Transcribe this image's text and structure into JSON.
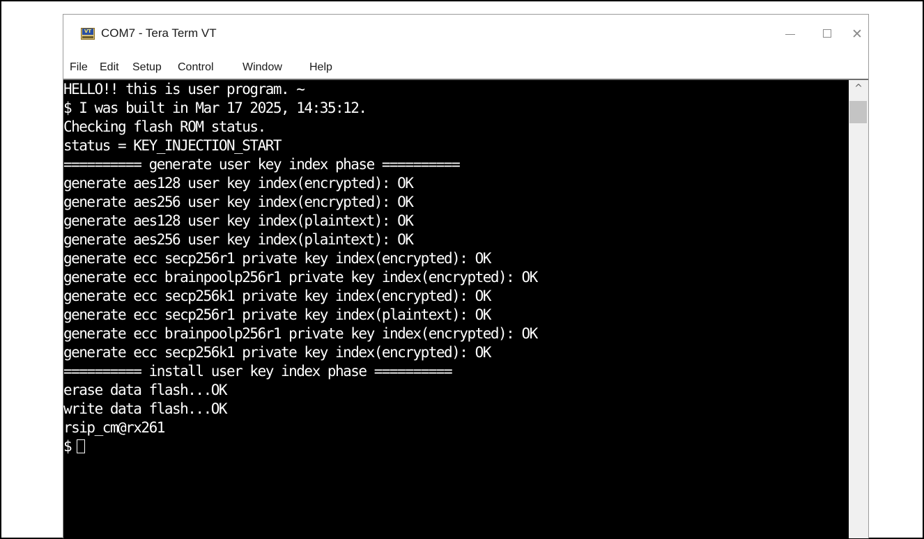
{
  "window": {
    "title": "COM7 - Tera Term VT",
    "icon_label": "VT",
    "icon": "tera-term-app-icon",
    "controls": {
      "minimize": "minimize-icon",
      "maximize": "maximize-icon",
      "close": "close-icon"
    }
  },
  "menu": {
    "file": "File",
    "edit": "Edit",
    "setup": "Setup",
    "control": "Control",
    "window": "Window",
    "help": "Help"
  },
  "terminal": {
    "lines": [
      "HELLO!! this is user program. ~",
      "$ I was built in Mar 17 2025, 14:35:12.",
      "Checking flash ROM status.",
      "status = KEY_INJECTION_START",
      "========== generate user key index phase ==========",
      "generate aes128 user key index(encrypted): OK",
      "generate aes256 user key index(encrypted): OK",
      "generate aes128 user key index(plaintext): OK",
      "generate aes256 user key index(plaintext): OK",
      "generate ecc secp256r1 private key index(encrypted): OK",
      "generate ecc brainpoolp256r1 private key index(encrypted): OK",
      "generate ecc secp256k1 private key index(encrypted): OK",
      "generate ecc secp256r1 private key index(plaintext): OK",
      "generate ecc brainpoolp256r1 private key index(encrypted): OK",
      "generate ecc secp256k1 private key index(encrypted): OK",
      "========== install user key index phase ==========",
      "erase data flash...OK",
      "write data flash...OK",
      "rsip_cm@rx261",
      "$"
    ]
  },
  "scrollbar": {
    "up_arrow": "^",
    "icon": "chevron-up-icon"
  },
  "colors": {
    "terminal_bg": "#000000",
    "terminal_fg": "#ffffff"
  }
}
